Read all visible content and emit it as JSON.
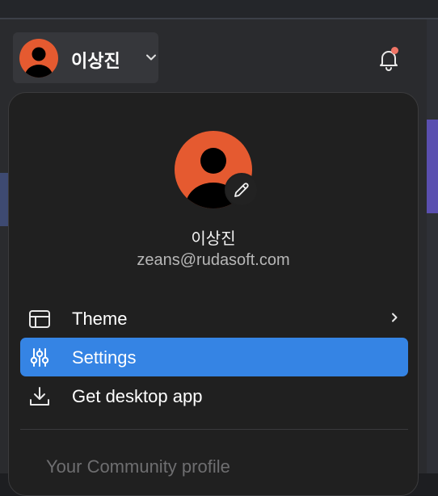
{
  "header": {
    "user_name": "이상진",
    "avatar_color": "#e55a30",
    "notification_dot": true,
    "notification_color": "#f07566"
  },
  "menu": {
    "profile_name": "이상진",
    "profile_email": "zeans@rudasoft.com",
    "items": [
      {
        "label": "Theme",
        "icon": "layout-icon",
        "has_submenu": true,
        "active": false
      },
      {
        "label": "Settings",
        "icon": "sliders-icon",
        "has_submenu": false,
        "active": true
      },
      {
        "label": "Get desktop app",
        "icon": "download-icon",
        "has_submenu": false,
        "active": false
      }
    ],
    "section_label": "Your Community profile"
  },
  "colors": {
    "active_item": "#3584e4",
    "menu_bg": "#202020"
  }
}
